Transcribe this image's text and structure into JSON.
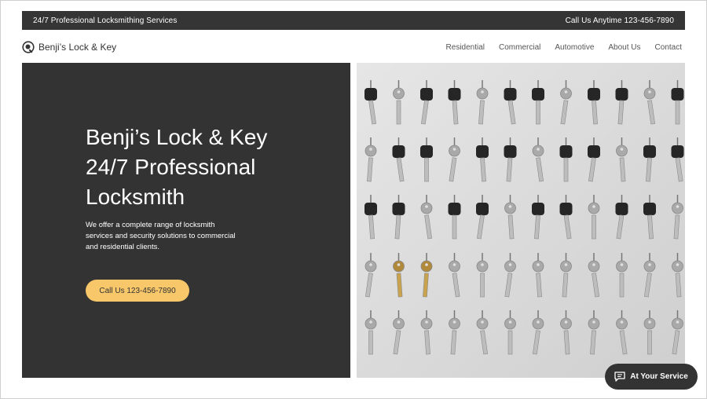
{
  "topbar": {
    "left_text": "24/7 Professional Locksmithing Services",
    "right_text": "Call Us Anytime 123-456-7890"
  },
  "header": {
    "brand_name": "Benji’s Lock & Key",
    "logo_icon": "magnifier-key-icon",
    "nav": [
      "Residential",
      "Commercial",
      "Automotive",
      "About Us",
      "Contact"
    ]
  },
  "hero": {
    "title_line1": "Benji’s Lock & Key",
    "title_line2": "24/7 Professional",
    "title_line3": "Locksmith",
    "desc_line1": "We offer a complete range of locksmith",
    "desc_line2": "services and security solutions to commercial",
    "desc_line3": "and residential clients.",
    "cta_label": "Call Us 123-456-7890",
    "image_subject": "rows of hanging keys",
    "colors": {
      "dark_panel": "#333333",
      "cta": "#f7c76a",
      "image_bg": "#dcdcdc"
    }
  },
  "chat": {
    "label": "At Your Service",
    "icon": "chat-bubble-icon"
  }
}
